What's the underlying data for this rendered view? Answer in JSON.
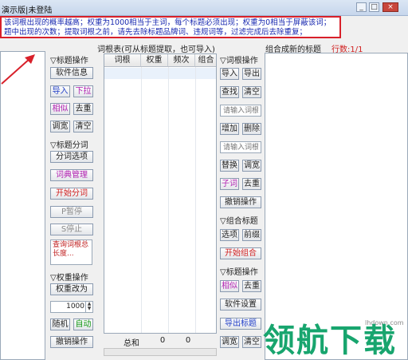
{
  "window": {
    "title": "演示版|未登陆",
    "min": "_",
    "max": "□",
    "close": "×"
  },
  "notice": {
    "line1": "该词根出现的概率越高；权重为1000相当于主词，每个标题必须出现；权重为0相当于屏蔽该词；",
    "line2": "题中出现的次数；提取词根之前，请先去除标题品牌词、违规词等，过滤完成后去除重复；"
  },
  "left": {
    "sec_title": "▽标题操作",
    "software_info": "软件信息",
    "import": "导入",
    "dropdown": "下拉",
    "similar": "相似",
    "dedupe": "去重",
    "adjust_width": "调宽",
    "clear": "清空",
    "sec_segment": "▽标题分词",
    "seg_options": "分词选项",
    "dict_manage": "词典管理",
    "start_seg": "开始分词",
    "pause": "P暂停",
    "stop": "S停止",
    "memo": "查询词根总长度...",
    "sec_weight": "▽权重操作",
    "weight_change": "权重改为",
    "weight_value": "1000",
    "random": "随机",
    "auto": "自动",
    "undo": "撤销操作"
  },
  "table": {
    "title": "词根表(可从标题提取，也可导入)",
    "columns": [
      "词根",
      "权重",
      "频次",
      "组合"
    ],
    "footer": {
      "label": "总和",
      "weight_sum": "0",
      "freq_sum": "0"
    }
  },
  "mid": {
    "sec_root": "▽词根操作",
    "import": "导入",
    "export": "导出",
    "find": "查找",
    "clear": "清空",
    "input_root_1": "请输入词根",
    "add": "增加",
    "delete": "删除",
    "input_root_2": "请输入词根",
    "replace": "替换",
    "adjust": "调宽",
    "sub_word": "子词",
    "dedupe": "去重",
    "undo": "撤销操作",
    "sec_combine": "▽组合标题",
    "options": "选项",
    "prefix": "前缀",
    "start_combine": "开始组合",
    "sec_title_op": "▽标题操作",
    "similar": "相似",
    "dedupe2": "去重",
    "software_settings": "软件设置",
    "export_title": "导出标题",
    "adjust_width": "调宽",
    "clear2": "清空"
  },
  "right": {
    "title": "组合成新的标题",
    "rows": "行数:1/1"
  },
  "watermark": {
    "url": "lhdown.com",
    "text": "领航下载"
  },
  "colors": {
    "notice_border": "#d8202a",
    "notice_text": "#1a2ab0",
    "brand": "#18a56e"
  }
}
